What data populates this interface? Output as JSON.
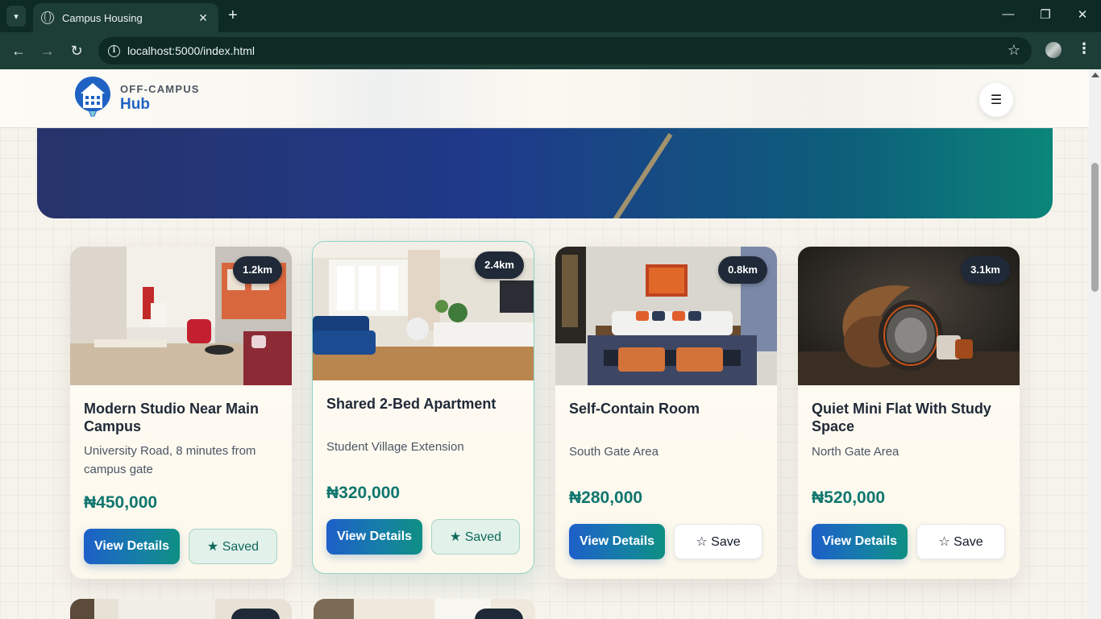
{
  "browser": {
    "tab_title": "Campus Housing",
    "url": "localhost:5000/index.html"
  },
  "site": {
    "brand_top": "OFF-CAMPUS",
    "brand_bottom": "Hub",
    "menu_icon": "☰"
  },
  "listings": [
    {
      "name": "Modern Studio Near Main Campus",
      "location": "University Road, 8 minutes from campus gate",
      "price": "₦450,000",
      "distance": "1.2km",
      "view_label": "View Details",
      "save_label": "★ Saved",
      "saved": true
    },
    {
      "name": "Shared 2-Bed Apartment",
      "location": "Student Village Extension",
      "price": "₦320,000",
      "distance": "2.4km",
      "view_label": "View Details",
      "save_label": "★ Saved",
      "saved": true
    },
    {
      "name": "Self-Contain Room",
      "location": "South Gate Area",
      "price": "₦280,000",
      "distance": "0.8km",
      "view_label": "View Details",
      "save_label": "☆ Save",
      "saved": false
    },
    {
      "name": "Quiet Mini Flat With Study Space",
      "location": "North Gate Area",
      "price": "₦520,000",
      "distance": "3.1km",
      "view_label": "View Details",
      "save_label": "☆ Save",
      "saved": false
    }
  ],
  "colors": {
    "brand_blue": "#1f62c4",
    "price_teal": "#0f766e",
    "hero_start": "#27336a",
    "hero_end": "#0b8579"
  }
}
